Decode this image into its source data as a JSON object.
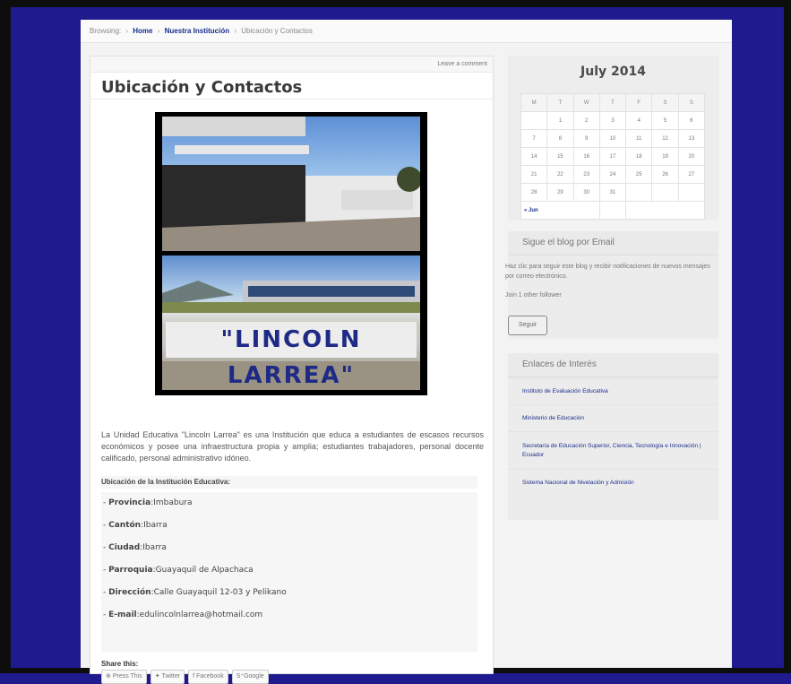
{
  "breadcrumb": {
    "browsing": "Browsing:",
    "home": "Home",
    "section": "Nuestra Institución",
    "current": "Ubicación y Contactos",
    "sep": "›"
  },
  "post": {
    "meta": "Leave a comment",
    "title": "Ubicación y Contactos",
    "photo_sign": "\"LINCOLN LARREA\"",
    "body": "La Unidad Educativa \"Lincoln Larrea\" es una Institución que educa a estudiantes de escasos recursos económicos y posee una infraestructura propia y amplia; estudiantes trabajadores, personal docente calificado, personal administrativo idóneo.",
    "location_heading": "Ubicación de la Institución Educativa:",
    "location": [
      {
        "label": "Provincia",
        "value": ":Imbabura"
      },
      {
        "label": "Cantón",
        "value": ":Ibarra"
      },
      {
        "label": "Ciudad",
        "value": ":Ibarra"
      },
      {
        "label": "Parroquia",
        "value": ":Guayaquil de Alpachaca"
      },
      {
        "label": "Dirección",
        "value": ":Calle Guayaquil 12-03 y Pelikano"
      },
      {
        "label": "E-mail",
        "value": ":edulincolnlarrea@hotmail.com"
      }
    ],
    "share_title": "Share this:",
    "share_buttons": [
      "Press This",
      "Twitter",
      "Facebook",
      "Google"
    ]
  },
  "calendar": {
    "title": "July 2014",
    "days": [
      "M",
      "T",
      "W",
      "T",
      "F",
      "S",
      "S"
    ],
    "weeks": [
      [
        "",
        "1",
        "2",
        "3",
        "4",
        "5",
        "6"
      ],
      [
        "7",
        "8",
        "9",
        "10",
        "11",
        "12",
        "13"
      ],
      [
        "14",
        "15",
        "16",
        "17",
        "18",
        "19",
        "20"
      ],
      [
        "21",
        "22",
        "23",
        "24",
        "25",
        "26",
        "27"
      ],
      [
        "28",
        "29",
        "30",
        "31",
        "",
        "",
        ""
      ]
    ],
    "prev": "« Jun"
  },
  "email_widget": {
    "title": "Sigue el blog por Email",
    "text": "Haz clic para seguir este blog y recibir notificaciones de nuevos mensajes por correo electrónico.",
    "followers": "Join 1 other follower",
    "button": "Seguir"
  },
  "links_widget": {
    "title": "Enlaces de Interés",
    "items": [
      "Instituto de Evaluación Educativa",
      "Ministerio de Educación",
      "Secretaría de Educación Superior, Ciencia, Tecnología e Innovación | Ecuador",
      "Sistema Nacional de Nivelación y Admisión"
    ]
  }
}
